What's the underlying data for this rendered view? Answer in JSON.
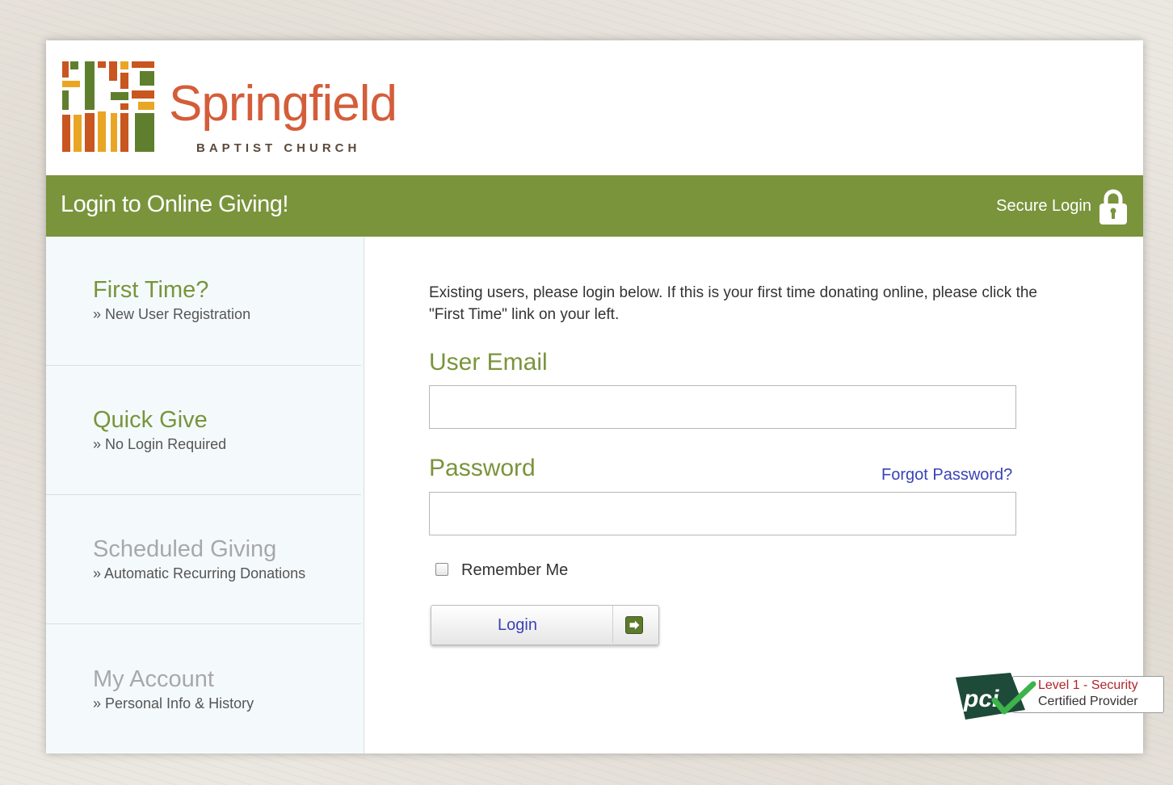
{
  "brand": {
    "name": "Springfield",
    "subtitle": "BAPTIST CHURCH",
    "colors": {
      "green": "#7a943c",
      "orange": "#d45d3a",
      "link_blue": "#3a43b5"
    }
  },
  "header": {
    "title": "Login to Online Giving!",
    "secure_label": "Secure Login",
    "secure_icon": "lock-icon"
  },
  "sidebar": {
    "items": [
      {
        "title": "First Time?",
        "subtitle": "» New User Registration",
        "title_color": "#7a943c"
      },
      {
        "title": "Quick Give",
        "subtitle": "» No Login Required",
        "title_color": "#7a943c"
      },
      {
        "title": "Scheduled Giving",
        "subtitle": "» Automatic Recurring Donations",
        "title_color": "#a8a8a8"
      },
      {
        "title": "My Account",
        "subtitle": "» Personal Info & History",
        "title_color": "#a8a8a8"
      }
    ]
  },
  "form": {
    "intro": "Existing users, please login below. If this is your first time donating online, please click the \"First Time\" link on your left.",
    "email_label": "User Email",
    "email_value": "",
    "password_label": "Password",
    "password_value": "",
    "forgot_label": "Forgot Password?",
    "remember_label": "Remember Me",
    "remember_checked": false,
    "login_label": "Login",
    "login_icon": "arrow-right-icon"
  },
  "badge": {
    "logo_text": "pci",
    "line1": "Level 1 - Security",
    "line2": "Certified Provider"
  }
}
